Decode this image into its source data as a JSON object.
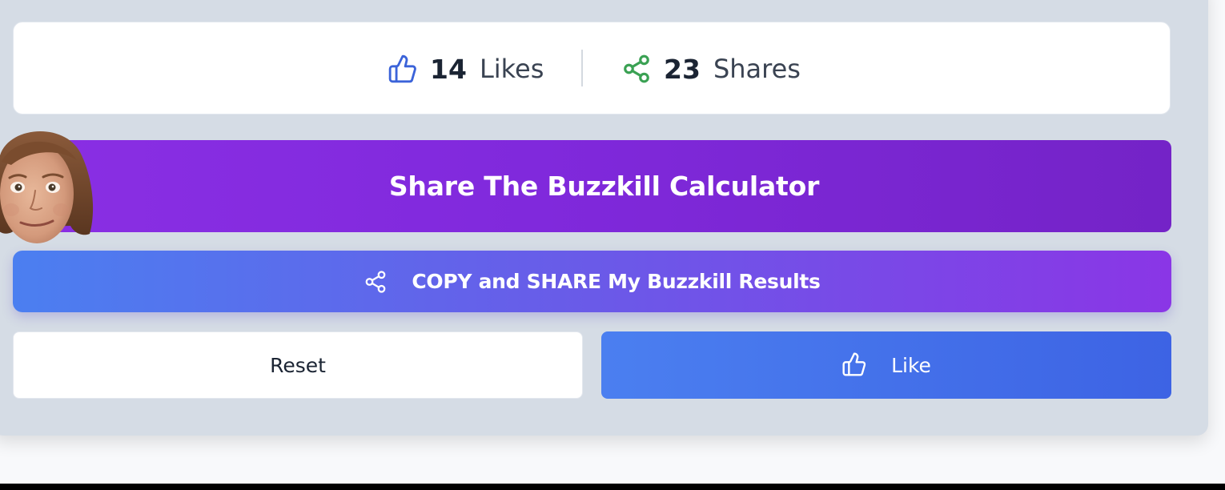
{
  "stats": {
    "likes": {
      "icon": "thumbs-up-icon",
      "count": "14",
      "label": "Likes",
      "color": "#3b63d9"
    },
    "shares": {
      "icon": "share-icon",
      "count": "23",
      "label": "Shares",
      "color": "#3aa153"
    }
  },
  "share_banner": {
    "title": "Share The Buzzkill Calculator",
    "avatar": "face-avatar"
  },
  "actions": {
    "copy_share_label": "COPY and SHARE My Buzzkill Results",
    "copy_share_icon": "share-icon",
    "reset_label": "Reset",
    "like_label": "Like",
    "like_icon": "thumbs-up-icon"
  },
  "colors": {
    "banner_purple": "#8029dc",
    "primary_blue": "#4b7ff0",
    "card_background": "#d5dce5"
  }
}
